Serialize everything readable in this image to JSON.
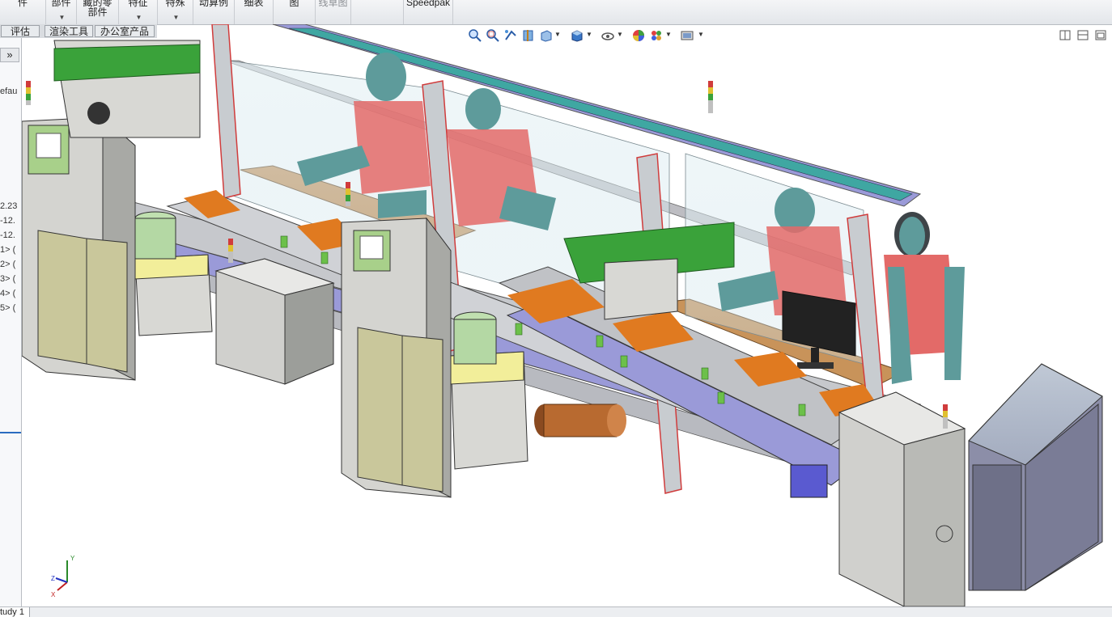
{
  "ribbon": {
    "groups": [
      {
        "l1": "件",
        "l2": "",
        "dim": false
      },
      {
        "l1": "部件",
        "l2": "",
        "dim": false
      },
      {
        "l1": "藏的零",
        "l2": "部件",
        "dim": false
      },
      {
        "l1": "特征",
        "l2": "",
        "dim": false
      },
      {
        "l1": "特殊",
        "l2": "",
        "dim": false
      },
      {
        "l1": "动算例",
        "l2": "",
        "dim": false
      },
      {
        "l1": "细表",
        "l2": "",
        "dim": false
      },
      {
        "l1": "图",
        "l2": "",
        "dim": false
      },
      {
        "l1": "线草图",
        "l2": "",
        "dim": true
      },
      {
        "l1": "Speedpak",
        "l2": "",
        "dim": false
      }
    ]
  },
  "tabs": [
    "评估",
    "渲染工具",
    "办公室产品"
  ],
  "left_panel": {
    "collapse_glyph": "»",
    "rows": [
      "efau",
      "2.23",
      "-12.",
      "-12.",
      "1> (",
      "2> (",
      "3> (",
      "4> (",
      "5> ("
    ]
  },
  "heads_up_toolbar": {
    "icons": [
      "zoom-to-fit-icon",
      "zoom-area-icon",
      "previous-view-icon",
      "section-view-icon",
      "view-orientation-icon",
      "display-style-icon",
      "hide-show-icon",
      "edit-appearance-icon",
      "apply-scene-icon",
      "view-settings-icon"
    ]
  },
  "triad": {
    "x": "X",
    "y": "Y",
    "z": "Z"
  },
  "status": {
    "study_tab": "tudy 1"
  },
  "colors": {
    "frame_gray": "#c8ccd0",
    "panel_khaki": "#c9c79b",
    "cabinet_gray": "#d8d8d4",
    "conveyor_blue": "#9a9ad8",
    "orange_fixture": "#e07a20",
    "wood_bench": "#c8935a",
    "mannequin_body": "#e36a68",
    "mannequin_limb": "#5e9b9b",
    "green_board": "#3aa23a",
    "red_post": "#d03c3c",
    "glass": "#cfe6ee"
  }
}
